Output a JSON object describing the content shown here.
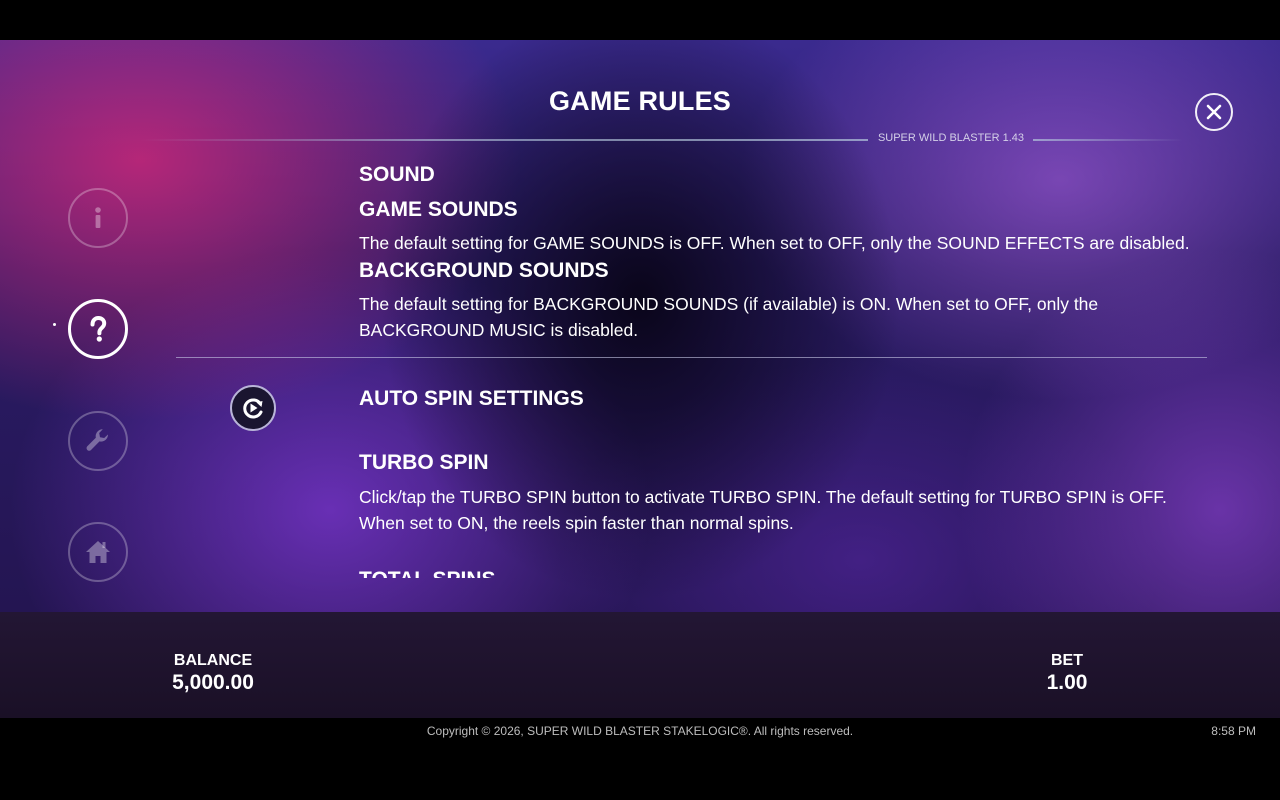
{
  "header": {
    "title": "GAME RULES",
    "version": "SUPER WILD BLASTER 1.43",
    "close_label": "X"
  },
  "sidebar": {
    "items": [
      {
        "name": "info",
        "icon": "info-icon",
        "active": false
      },
      {
        "name": "help",
        "icon": "question-icon",
        "active": true
      },
      {
        "name": "settings",
        "icon": "wrench-icon",
        "active": false
      },
      {
        "name": "home",
        "icon": "home-icon",
        "active": false
      }
    ]
  },
  "rules": {
    "sound_heading": "SOUND",
    "game_sounds_heading": "GAME SOUNDS",
    "game_sounds_text": "The default setting for GAME SOUNDS is OFF. When set to OFF, only the SOUND EFFECTS are disabled.",
    "background_sounds_heading": "BACKGROUND SOUNDS",
    "background_sounds_text": "The default setting for BACKGROUND SOUNDS (if available) is ON. When set to OFF, only the BACKGROUND MUSIC is disabled.",
    "autospin_heading": "AUTO SPIN SETTINGS",
    "turbo_heading": "TURBO SPIN",
    "turbo_text": "Click/tap the TURBO SPIN button to activate TURBO SPIN. The default setting for TURBO SPIN is OFF. When set to ON, the reels spin faster than normal spins.",
    "total_spins_heading": "TOTAL SPINS"
  },
  "footer_panel": {
    "balance_label": "BALANCE",
    "balance_value": "5,000.00",
    "bet_label": "BET",
    "bet_value": "1.00"
  },
  "footer": {
    "copyright": "Copyright © 2026, SUPER WILD BLASTER STAKELOGIC®. All rights reserved.",
    "time": "8:58 PM"
  },
  "colors": {
    "background_dark": "#000000",
    "panel": "#231634",
    "text": "#ffffff"
  }
}
